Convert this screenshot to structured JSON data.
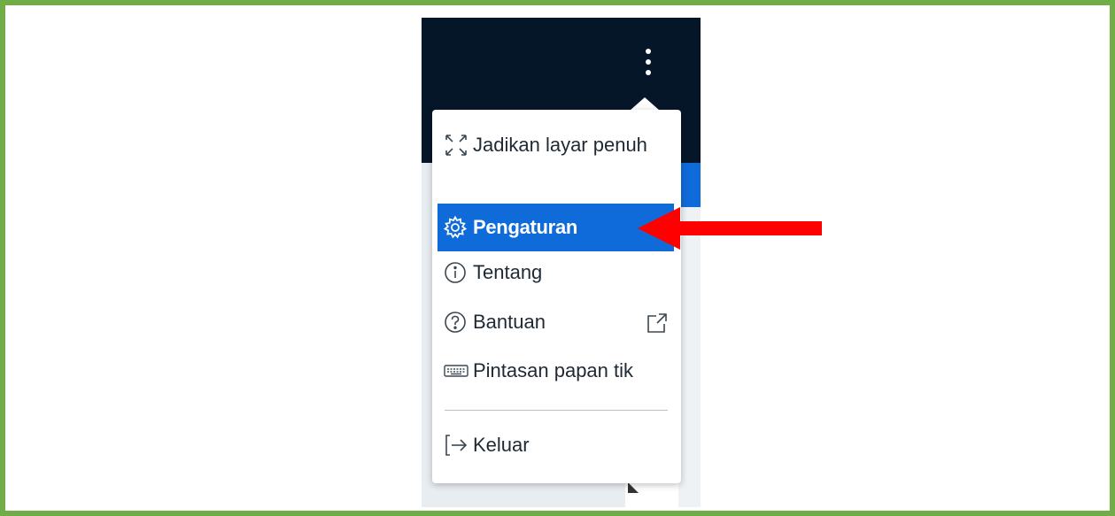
{
  "menu": {
    "items": [
      {
        "label": "Jadikan layar penuh",
        "icon": "fullscreen-icon"
      },
      {
        "label": "Pengaturan",
        "icon": "gear-icon",
        "selected": true
      },
      {
        "label": "Tentang",
        "icon": "info-icon"
      },
      {
        "label": "Bantuan",
        "icon": "help-icon",
        "trailing_icon": "external-link-icon"
      },
      {
        "label": "Pintasan papan tik",
        "icon": "keyboard-icon"
      },
      {
        "label": "Keluar",
        "icon": "logout-icon"
      }
    ]
  },
  "header": {
    "menu_icon": "kebab-menu-icon"
  },
  "colors": {
    "frame": "#70ad47",
    "header": "#061629",
    "accent": "#0f6bd9",
    "arrow": "#ff0000"
  }
}
